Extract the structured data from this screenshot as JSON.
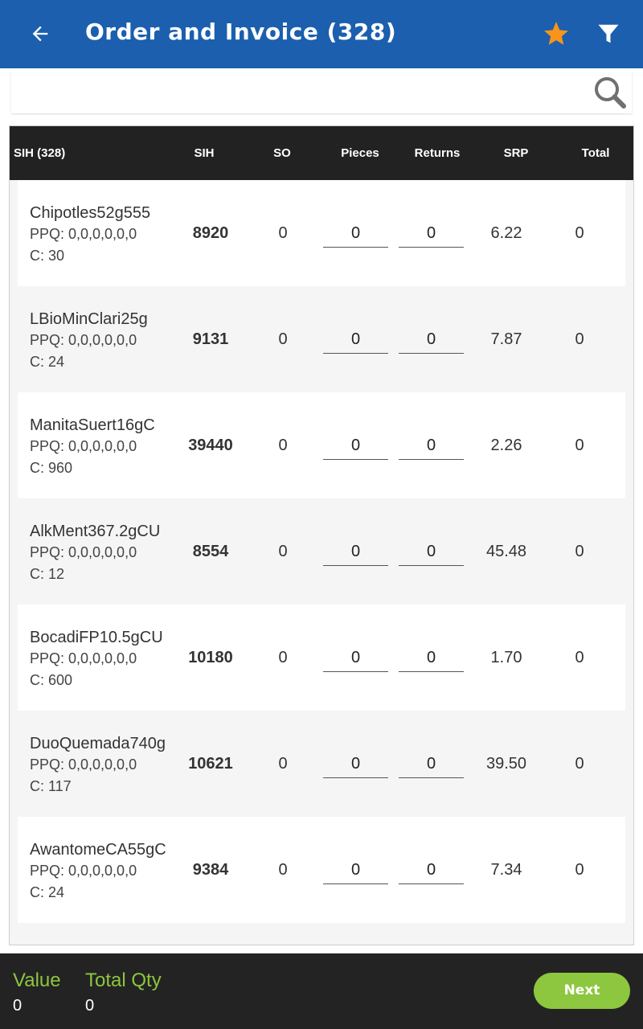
{
  "header": {
    "title": "Order and Invoice (328)",
    "back_icon": "back-arrow-icon",
    "star_icon": "star-icon",
    "filter_icon": "filter-icon",
    "accent_color": "#1b5fae",
    "star_color": "#f7941d"
  },
  "search": {
    "value": "",
    "placeholder": "",
    "icon": "search-icon"
  },
  "table": {
    "columns": [
      "SIH (328)",
      "SIH",
      "SO",
      "Pieces",
      "Returns",
      "SRP",
      "Total"
    ],
    "rows": [
      {
        "name": "Chipotles52g555",
        "ppq": "PPQ: 0,0,0,0,0,0",
        "case": "C: 30",
        "sih": "8920",
        "so": "0",
        "pieces": "0",
        "returns": "0",
        "srp": "6.22",
        "total": "0"
      },
      {
        "name": "LBioMinClari25g",
        "ppq": "PPQ: 0,0,0,0,0,0",
        "case": "C: 24",
        "sih": "9131",
        "so": "0",
        "pieces": "0",
        "returns": "0",
        "srp": "7.87",
        "total": "0"
      },
      {
        "name": "ManitaSuert16gC",
        "ppq": "PPQ: 0,0,0,0,0,0",
        "case": "C: 960",
        "sih": "39440",
        "so": "0",
        "pieces": "0",
        "returns": "0",
        "srp": "2.26",
        "total": "0"
      },
      {
        "name": "AlkMent367.2gCU",
        "ppq": "PPQ: 0,0,0,0,0,0",
        "case": "C: 12",
        "sih": "8554",
        "so": "0",
        "pieces": "0",
        "returns": "0",
        "srp": "45.48",
        "total": "0"
      },
      {
        "name": "BocadiFP10.5gCU",
        "ppq": "PPQ: 0,0,0,0,0,0",
        "case": "C: 600",
        "sih": "10180",
        "so": "0",
        "pieces": "0",
        "returns": "0",
        "srp": "1.70",
        "total": "0"
      },
      {
        "name": "DuoQuemada740g",
        "ppq": "PPQ: 0,0,0,0,0,0",
        "case": "C: 117",
        "sih": "10621",
        "so": "0",
        "pieces": "0",
        "returns": "0",
        "srp": "39.50",
        "total": "0"
      },
      {
        "name": "AwantomeCA55gC",
        "ppq": "PPQ: 0,0,0,0,0,0",
        "case": "C: 24",
        "sih": "9384",
        "so": "0",
        "pieces": "0",
        "returns": "0",
        "srp": "7.34",
        "total": "0"
      }
    ]
  },
  "footer": {
    "value_label": "Value",
    "value": "0",
    "total_qty_label": "Total Qty",
    "total_qty": "0",
    "next_label": "Next",
    "label_color": "#8dc63f"
  }
}
